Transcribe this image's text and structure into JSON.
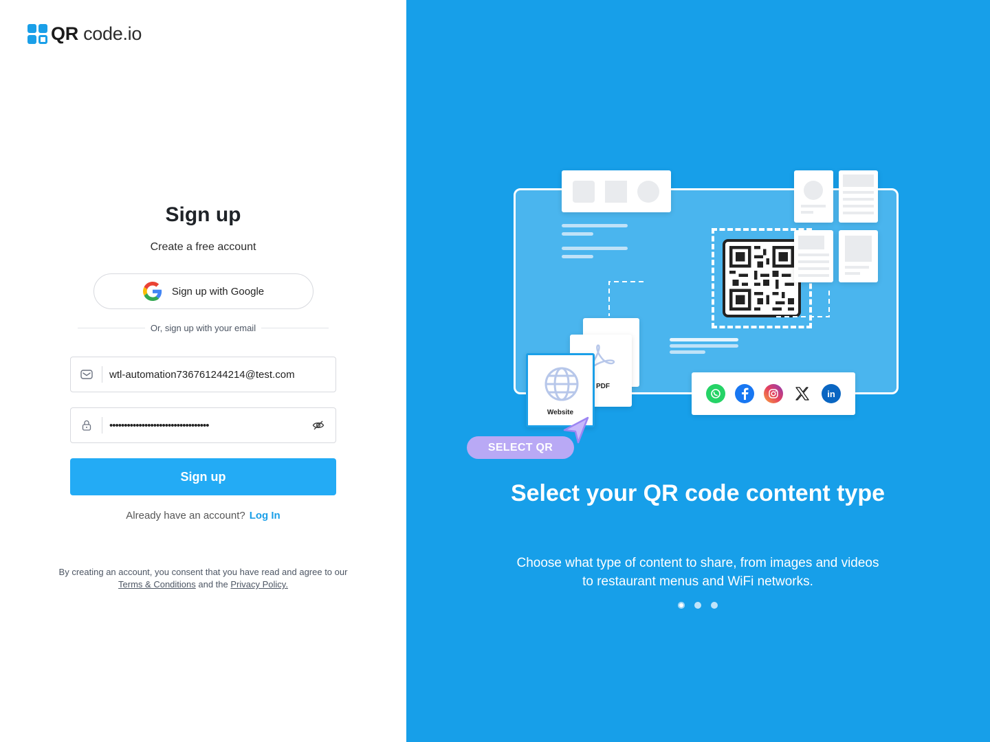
{
  "brand": {
    "name_bold": "QR",
    "name_rest": " code.io",
    "color": "#1a9fe8"
  },
  "signup": {
    "title": "Sign up",
    "subtitle": "Create a free account",
    "google_label": "Sign up with Google",
    "divider_text": "Or, sign up with your email",
    "email_value": "wtl-automation736761244214@test.com",
    "password_value": "••••••••••••••••••••••••••••••••••",
    "submit_label": "Sign up",
    "have_account_text": "Already have an account?",
    "login_link": "Log In",
    "legal_prefix": "By creating an account, you consent that you have read and agree to our ",
    "terms_link": "Terms & Conditions",
    "legal_middle": " and the ",
    "privacy_link": "Privacy Policy."
  },
  "promo": {
    "pill_label": "SELECT QR",
    "website_label": "Website",
    "pdf_label": "PDF",
    "title": "Select your QR code content type",
    "description": "Choose what type of content to share, from images and videos to restaurant menus and WiFi networks.",
    "slides": 3,
    "active_slide": 1,
    "social_icons": [
      "whatsapp-icon",
      "facebook-icon",
      "instagram-icon",
      "x-icon",
      "linkedin-icon"
    ],
    "background_color": "#179fe9"
  },
  "colors": {
    "accent": "#23abf5",
    "link": "#1a9fe8"
  }
}
